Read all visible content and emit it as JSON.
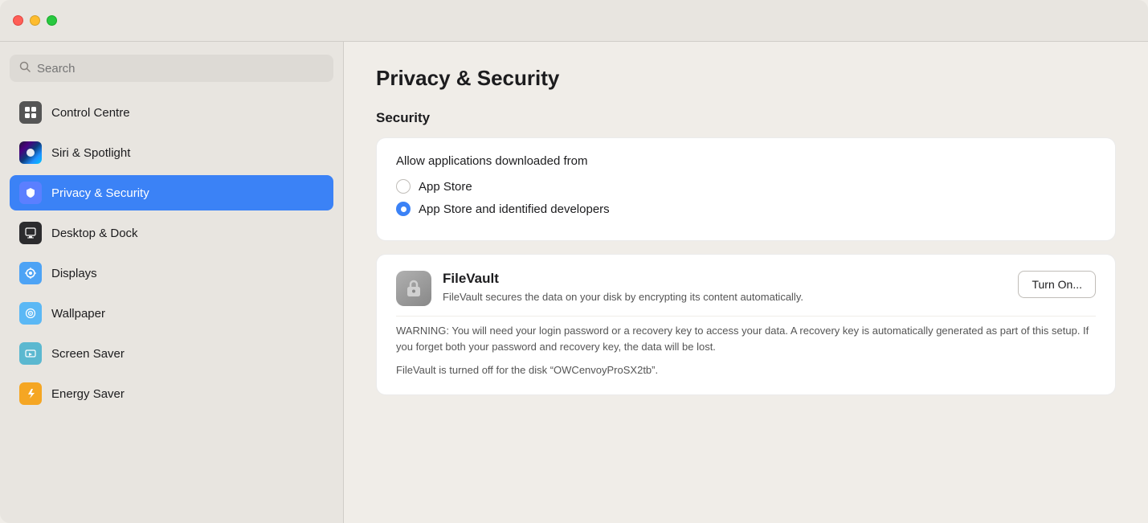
{
  "window": {
    "title": "Privacy & Security"
  },
  "trafficLights": {
    "close_label": "Close",
    "minimize_label": "Minimize",
    "maximize_label": "Maximize"
  },
  "sidebar": {
    "search_placeholder": "Search",
    "items": [
      {
        "id": "control-centre",
        "label": "Control Centre",
        "icon": "control-centre",
        "active": false
      },
      {
        "id": "siri-spotlight",
        "label": "Siri & Spotlight",
        "icon": "siri",
        "active": false
      },
      {
        "id": "privacy-security",
        "label": "Privacy & Security",
        "icon": "privacy",
        "active": true
      },
      {
        "id": "desktop-dock",
        "label": "Desktop & Dock",
        "icon": "desktop",
        "active": false
      },
      {
        "id": "displays",
        "label": "Displays",
        "icon": "displays",
        "active": false
      },
      {
        "id": "wallpaper",
        "label": "Wallpaper",
        "icon": "wallpaper",
        "active": false
      },
      {
        "id": "screen-saver",
        "label": "Screen Saver",
        "icon": "screensaver",
        "active": false
      },
      {
        "id": "energy-saver",
        "label": "Energy Saver",
        "icon": "energy",
        "active": false
      }
    ]
  },
  "content": {
    "page_title": "Privacy & Security",
    "security_section_title": "Security",
    "allow_from_label": "Allow applications downloaded from",
    "radio_options": [
      {
        "id": "app-store",
        "label": "App Store",
        "selected": false
      },
      {
        "id": "app-store-devs",
        "label": "App Store and identified developers",
        "selected": true
      }
    ],
    "filevault": {
      "title": "FileVault",
      "description": "FileVault secures the data on your disk by encrypting its content automatically.",
      "turn_on_label": "Turn On...",
      "warning_text": "WARNING: You will need your login password or a recovery key to access your data. A recovery key is automatically generated as part of this setup. If you forget both your password and recovery key, the data will be lost.",
      "status_text": "FileVault is turned off for the disk “OWCenvoyProSX2tb”."
    }
  }
}
